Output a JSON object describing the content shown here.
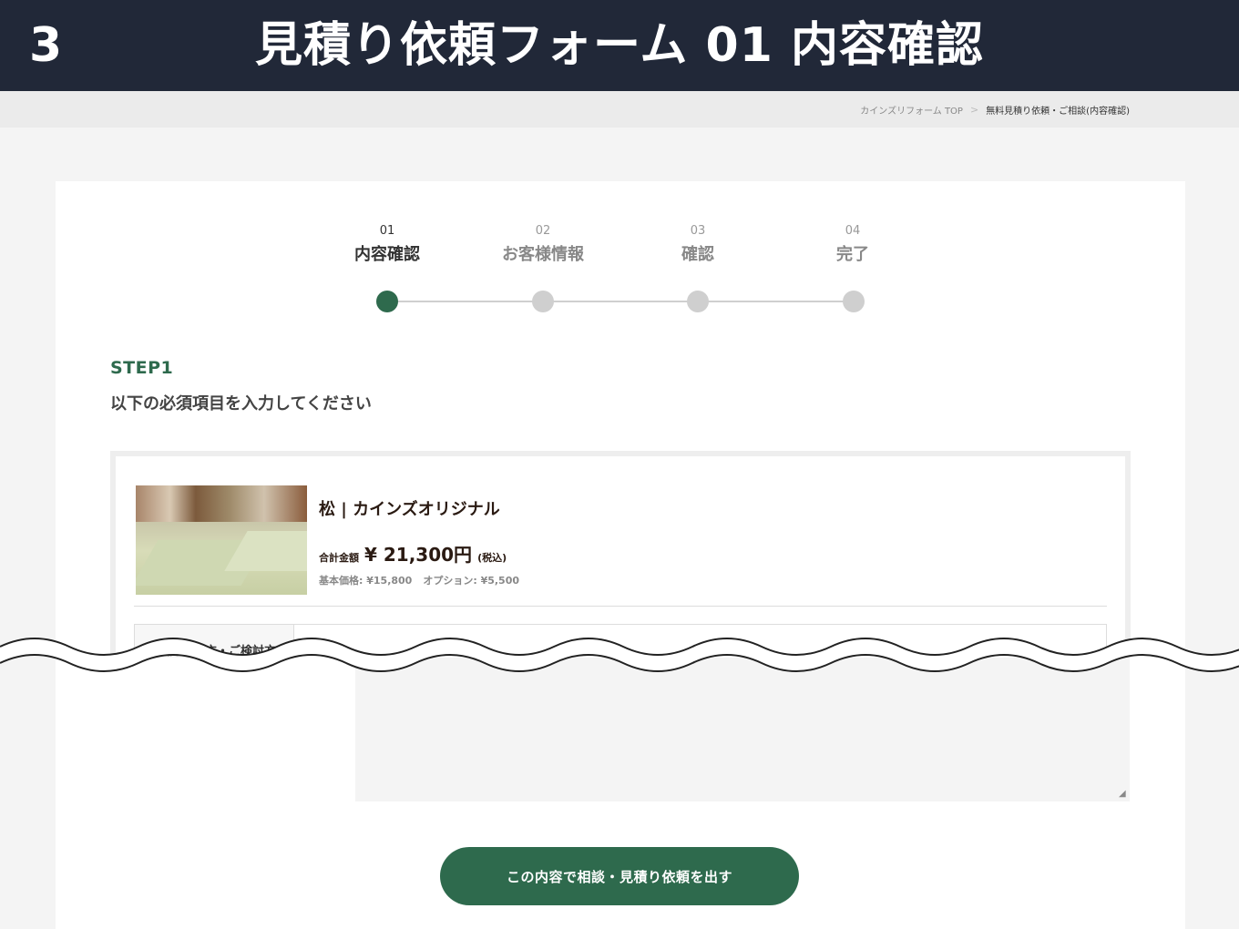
{
  "slide": {
    "number": "3",
    "title": "見積り依頼フォーム 01 内容確認"
  },
  "breadcrumb": {
    "home": "カインズリフォーム TOP",
    "separator": ">",
    "current": "無料見積り依頼・ご相談(内容確認)"
  },
  "steps": [
    {
      "number": "01",
      "label": "内容確認",
      "active": true
    },
    {
      "number": "02",
      "label": "お客様情報",
      "active": false
    },
    {
      "number": "03",
      "label": "確認",
      "active": false
    },
    {
      "number": "04",
      "label": "完了",
      "active": false
    }
  ],
  "section": {
    "step_heading": "STEP1",
    "instruction": "以下の必須項目を入力してください"
  },
  "product": {
    "image_alt": "tatami room photo",
    "name": "松 | カインズオリジナル",
    "price_label": "合計金額",
    "price_value": "¥ 21,300円",
    "price_tax": "(税込)",
    "base_price": "基本価格: ¥15,800",
    "option_price": "オプション: ¥5,500"
  },
  "form": {
    "field_label": "ご検討頂く方・ご検討方"
  },
  "actions": {
    "submit_label": "この内容で相談・見積り依頼を出す"
  },
  "colors": {
    "header_bg": "#212838",
    "accent_green": "#2e6a4d",
    "inactive_gray": "#cfcfcf"
  }
}
